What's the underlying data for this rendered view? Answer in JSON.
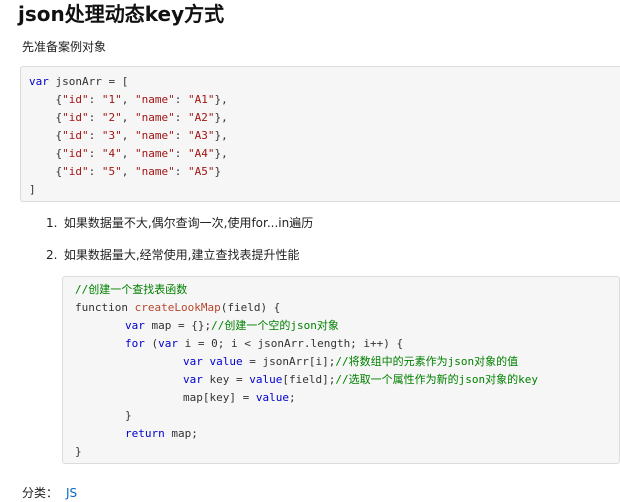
{
  "page": {
    "title": "json处理动态key方式",
    "intro": "先准备案例对象"
  },
  "code_block_1": {
    "lines": [
      {
        "kw": "var",
        "rest": " jsonArr = ["
      },
      {
        "p1": "    {",
        "k1": "\"id\"",
        "p2": ": ",
        "v1": "\"1\"",
        "p3": ", ",
        "k2": "\"name\"",
        "p4": ": ",
        "v2": "\"A1\"",
        "p5": "},"
      },
      {
        "p1": "    {",
        "k1": "\"id\"",
        "p2": ": ",
        "v1": "\"2\"",
        "p3": ", ",
        "k2": "\"name\"",
        "p4": ": ",
        "v2": "\"A2\"",
        "p5": "},"
      },
      {
        "p1": "    {",
        "k1": "\"id\"",
        "p2": ": ",
        "v1": "\"3\"",
        "p3": ", ",
        "k2": "\"name\"",
        "p4": ": ",
        "v2": "\"A3\"",
        "p5": "},"
      },
      {
        "p1": "    {",
        "k1": "\"id\"",
        "p2": ": ",
        "v1": "\"4\"",
        "p3": ", ",
        "k2": "\"name\"",
        "p4": ": ",
        "v2": "\"A4\"",
        "p5": "},"
      },
      {
        "p1": "    {",
        "k1": "\"id\"",
        "p2": ": ",
        "v1": "\"5\"",
        "p3": ", ",
        "k2": "\"name\"",
        "p4": ": ",
        "v2": "\"A5\"",
        "p5": "}"
      },
      {
        "rest": "]"
      }
    ]
  },
  "list": {
    "item1_num": "1.",
    "item1_text": "如果数据量不大,偶尔查询一次,使用for...in遍历",
    "item2_num": "2.",
    "item2_text": "如果数据量大,经常使用,建立查找表提升性能"
  },
  "code_block_2": {
    "comment1": "//创建一个查找表函数",
    "fn_kw": "function ",
    "fn_name": "createLookMap",
    "fn_args": "(field) {",
    "l3_kw": "var",
    "l3_rest": " map = {};",
    "l3_cm": "//创建一个空的json对象",
    "l4_kw": "for",
    "l4_p1": " (",
    "l4_kw2": "var",
    "l4_rest": " i = 0; i < jsonArr.length; i++) {",
    "l5_kw": "var",
    "l5_kw2": " value",
    "l5_rest": " = jsonArr[i];",
    "l5_cm": "//将数组中的元素作为json对象的值",
    "l6_kw": "var",
    "l6_rest1": " key = ",
    "l6_kw2": "value",
    "l6_rest2": "[field];",
    "l6_cm": "//选取一个属性作为新的json对象的key",
    "l7_p1": "map[key] = ",
    "l7_kw": "value",
    "l7_p2": ";",
    "l8": "}",
    "l9_kw": "return",
    "l9_rest": " map;",
    "l10": "}"
  },
  "footer": {
    "category_label": "分类：",
    "category_value": "JS"
  }
}
